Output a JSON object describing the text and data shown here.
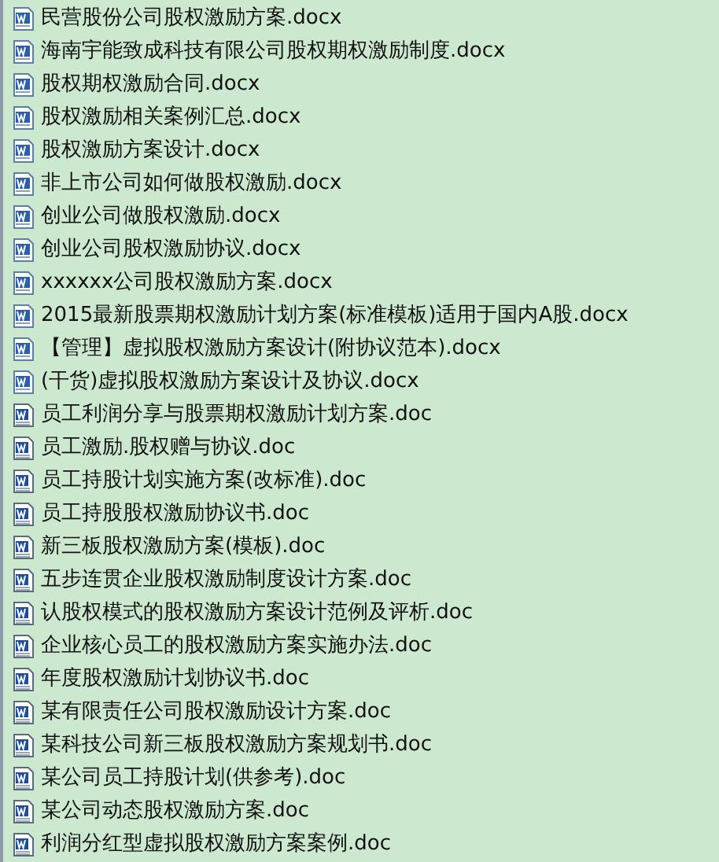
{
  "files": [
    {
      "name": "民营股份公司股权激励方案.docx",
      "kind": "docx"
    },
    {
      "name": "海南宇能致成科技有限公司股权期权激励制度.docx",
      "kind": "docx"
    },
    {
      "name": "股权期权激励合同.docx",
      "kind": "docx"
    },
    {
      "name": "股权激励相关案例汇总.docx",
      "kind": "docx"
    },
    {
      "name": "股权激励方案设计.docx",
      "kind": "docx"
    },
    {
      "name": "非上市公司如何做股权激励.docx",
      "kind": "docx"
    },
    {
      "name": "创业公司做股权激励.docx",
      "kind": "docx"
    },
    {
      "name": "创业公司股权激励协议.docx",
      "kind": "docx"
    },
    {
      "name": "xxxxxx公司股权激励方案.docx",
      "kind": "docx"
    },
    {
      "name": "2015最新股票期权激励计划方案(标准模板)适用于国内A股.docx",
      "kind": "docx"
    },
    {
      "name": "【管理】虚拟股权激励方案设计(附协议范本).docx",
      "kind": "docx"
    },
    {
      "name": "(干货)虚拟股权激励方案设计及协议.docx",
      "kind": "docx"
    },
    {
      "name": "员工利润分享与股票期权激励计划方案.doc",
      "kind": "doc"
    },
    {
      "name": "员工激励.股权赠与协议.doc",
      "kind": "doc"
    },
    {
      "name": "员工持股计划实施方案(改标准).doc",
      "kind": "doc"
    },
    {
      "name": "员工持股股权激励协议书.doc",
      "kind": "doc"
    },
    {
      "name": "新三板股权激励方案(模板).doc",
      "kind": "doc"
    },
    {
      "name": "五步连贯企业股权激励制度设计方案.doc",
      "kind": "doc"
    },
    {
      "name": "认股权模式的股权激励方案设计范例及评析.doc",
      "kind": "doc"
    },
    {
      "name": "企业核心员工的股权激励方案实施办法.doc",
      "kind": "doc"
    },
    {
      "name": "年度股权激励计划协议书.doc",
      "kind": "doc"
    },
    {
      "name": "某有限责任公司股权激励设计方案.doc",
      "kind": "doc"
    },
    {
      "name": "某科技公司新三板股权激励方案规划书.doc",
      "kind": "doc"
    },
    {
      "name": "某公司员工持股计划(供参考).doc",
      "kind": "doc"
    },
    {
      "name": "某公司动态股权激励方案.doc",
      "kind": "doc"
    },
    {
      "name": "利润分红型虚拟股权激励方案案例.doc",
      "kind": "doc"
    }
  ]
}
